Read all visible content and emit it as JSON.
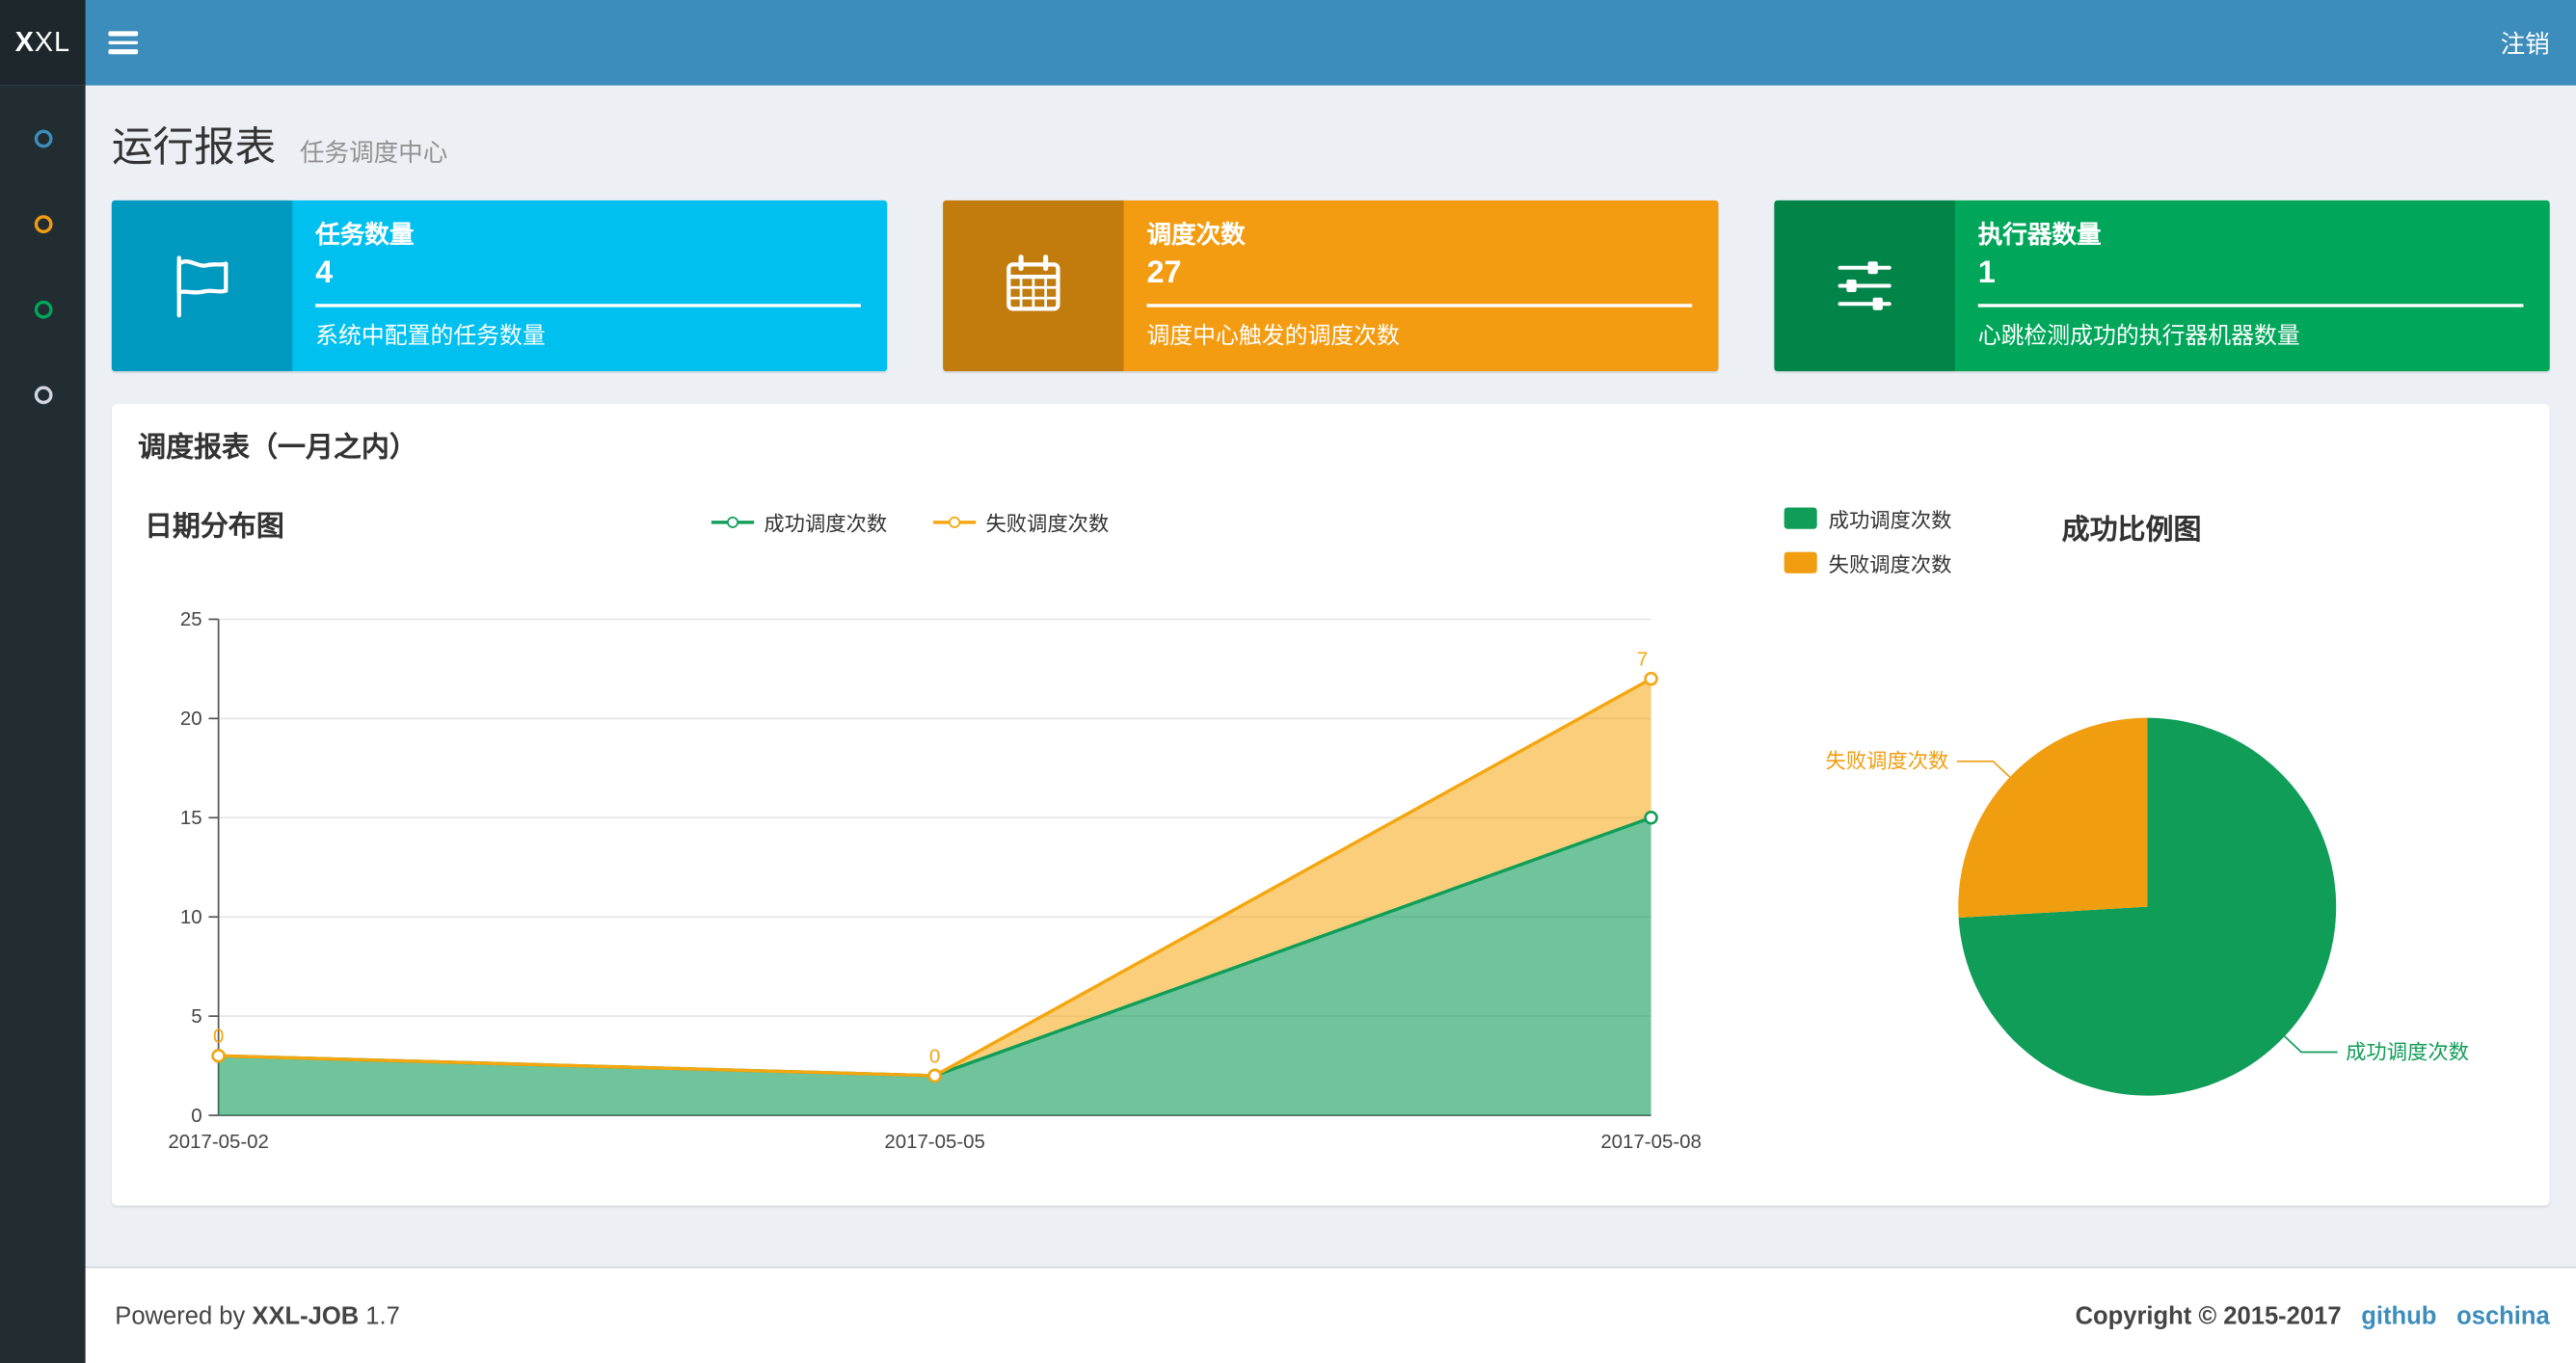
{
  "navbar": {
    "logo_bold": "X",
    "logo_rest": "XL",
    "logout": "注销"
  },
  "sidebar": {
    "items": [
      {
        "color": "#3c8dbc"
      },
      {
        "color": "#f39c12"
      },
      {
        "color": "#00a65a"
      },
      {
        "color": "#d2d6de"
      }
    ]
  },
  "header": {
    "title": "运行报表",
    "subtitle": "任务调度中心"
  },
  "info_boxes": [
    {
      "label": "任务数量",
      "value": "4",
      "desc": "系统中配置的任务数量",
      "color": "#00c0ef",
      "icon": "flag-icon"
    },
    {
      "label": "调度次数",
      "value": "27",
      "desc": "调度中心触发的调度次数",
      "color": "#f39c12",
      "icon": "calendar-icon"
    },
    {
      "label": "执行器数量",
      "value": "1",
      "desc": "心跳检测成功的执行器机器数量",
      "color": "#00a65a",
      "icon": "sliders-icon"
    }
  ],
  "panel": {
    "title": "调度报表（一月之内）"
  },
  "chart_data": [
    {
      "type": "area",
      "title": "日期分布图",
      "stacked": true,
      "categories": [
        "2017-05-02",
        "2017-05-05",
        "2017-05-08"
      ],
      "series": [
        {
          "name": "成功调度次数",
          "color": "#109d58",
          "values": [
            3,
            2,
            15
          ]
        },
        {
          "name": "失败调度次数",
          "color": "#f5a60f",
          "values": [
            0,
            0,
            7
          ],
          "labels": [
            "0",
            "0",
            "7"
          ]
        }
      ],
      "xlabel": "",
      "ylabel": "",
      "ylim": [
        0,
        25
      ],
      "yticks": [
        0,
        5,
        10,
        15,
        20,
        25
      ],
      "grid": true,
      "legend_position": "top"
    },
    {
      "type": "pie",
      "title": "成功比例图",
      "slices": [
        {
          "name": "成功调度次数",
          "value": 20,
          "color": "#109d58"
        },
        {
          "name": "失败调度次数",
          "value": 7,
          "color": "#f09e10"
        }
      ],
      "legend": [
        "成功调度次数",
        "失败调度次数"
      ],
      "legend_position": "top-left"
    }
  ],
  "footer": {
    "powered_prefix": "Powered by",
    "product": "XXL-JOB",
    "version": "1.7",
    "copyright": "Copyright © 2015-2017",
    "links": [
      "github",
      "oschina"
    ]
  }
}
